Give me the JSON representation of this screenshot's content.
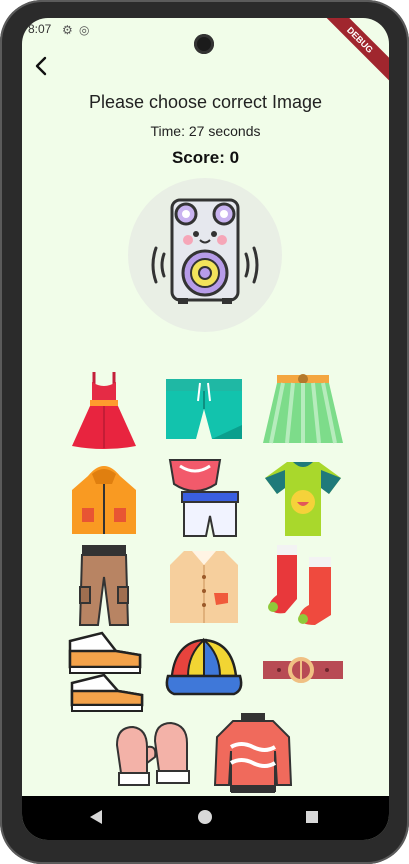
{
  "status": {
    "time": "8:07",
    "debug_banner": "DEBUG"
  },
  "header": {
    "title": "Please choose correct Image",
    "timer_text": "Time: 27 seconds",
    "score_text": "Score: 0"
  },
  "target": {
    "icon": "speaker-icon"
  },
  "options": [
    {
      "icon": "dress-icon"
    },
    {
      "icon": "shorts-icon"
    },
    {
      "icon": "skirt-icon"
    },
    {
      "icon": "jacket-icon"
    },
    {
      "icon": "underwear-icon"
    },
    {
      "icon": "tshirt-icon"
    },
    {
      "icon": "cargo-pants-icon"
    },
    {
      "icon": "shirt-icon"
    },
    {
      "icon": "socks-icon"
    },
    {
      "icon": "sneakers-icon"
    },
    {
      "icon": "cap-icon"
    },
    {
      "icon": "belt-icon"
    },
    {
      "icon": "mittens-icon"
    },
    {
      "icon": "sweater-icon"
    }
  ],
  "colors": {
    "background": "#f1fde9",
    "target_circle": "#e9efe5"
  }
}
